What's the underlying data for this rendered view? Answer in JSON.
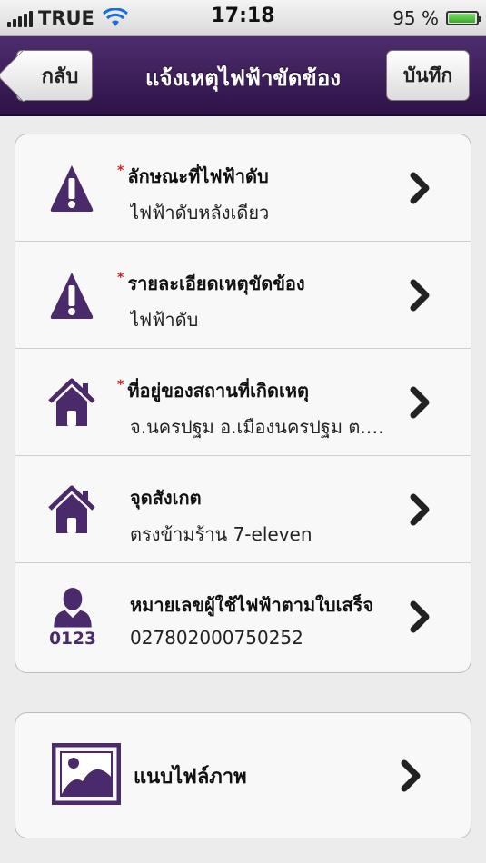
{
  "status_bar": {
    "carrier": "TRUE",
    "time": "17:18",
    "battery": "95 %",
    "battery_level": 0.95
  },
  "nav": {
    "back_label": "กลับ",
    "title": "แจ้งเหตุไฟฟ้าขัดข้อง",
    "save_label": "บันทึก"
  },
  "colors": {
    "accent": "#4a2a6a",
    "required": "#cc2222"
  },
  "form": {
    "items": [
      {
        "icon": "warning-icon",
        "required": true,
        "required_mark": "*",
        "title": "ลักษณะที่ไฟฟ้าดับ",
        "value": "ไฟฟ้าดับหลังเดียว"
      },
      {
        "icon": "warning-icon",
        "required": true,
        "required_mark": "*",
        "title": "รายละเอียดเหตุขัดข้อง",
        "value": "ไฟฟ้าดับ"
      },
      {
        "icon": "house-icon",
        "required": true,
        "required_mark": "*",
        "title": "ที่อยู่ของสถานที่เกิดเหตุ",
        "value": "จ.นครปฐม อ.เมืองนครปฐม ต.พ..."
      },
      {
        "icon": "house-icon",
        "required": false,
        "title": "จุดสังเกต",
        "value": "ตรงข้ามร้าน 7-eleven"
      },
      {
        "icon": "user-number-icon",
        "required": false,
        "title": "หมายเลขผู้ใช้ไฟฟ้าตามใบเสร็จ",
        "value": "027802000750252",
        "icon_text": "0123"
      }
    ]
  },
  "attachment": {
    "icon": "image-icon",
    "label": "แนบไฟล์ภาพ"
  }
}
